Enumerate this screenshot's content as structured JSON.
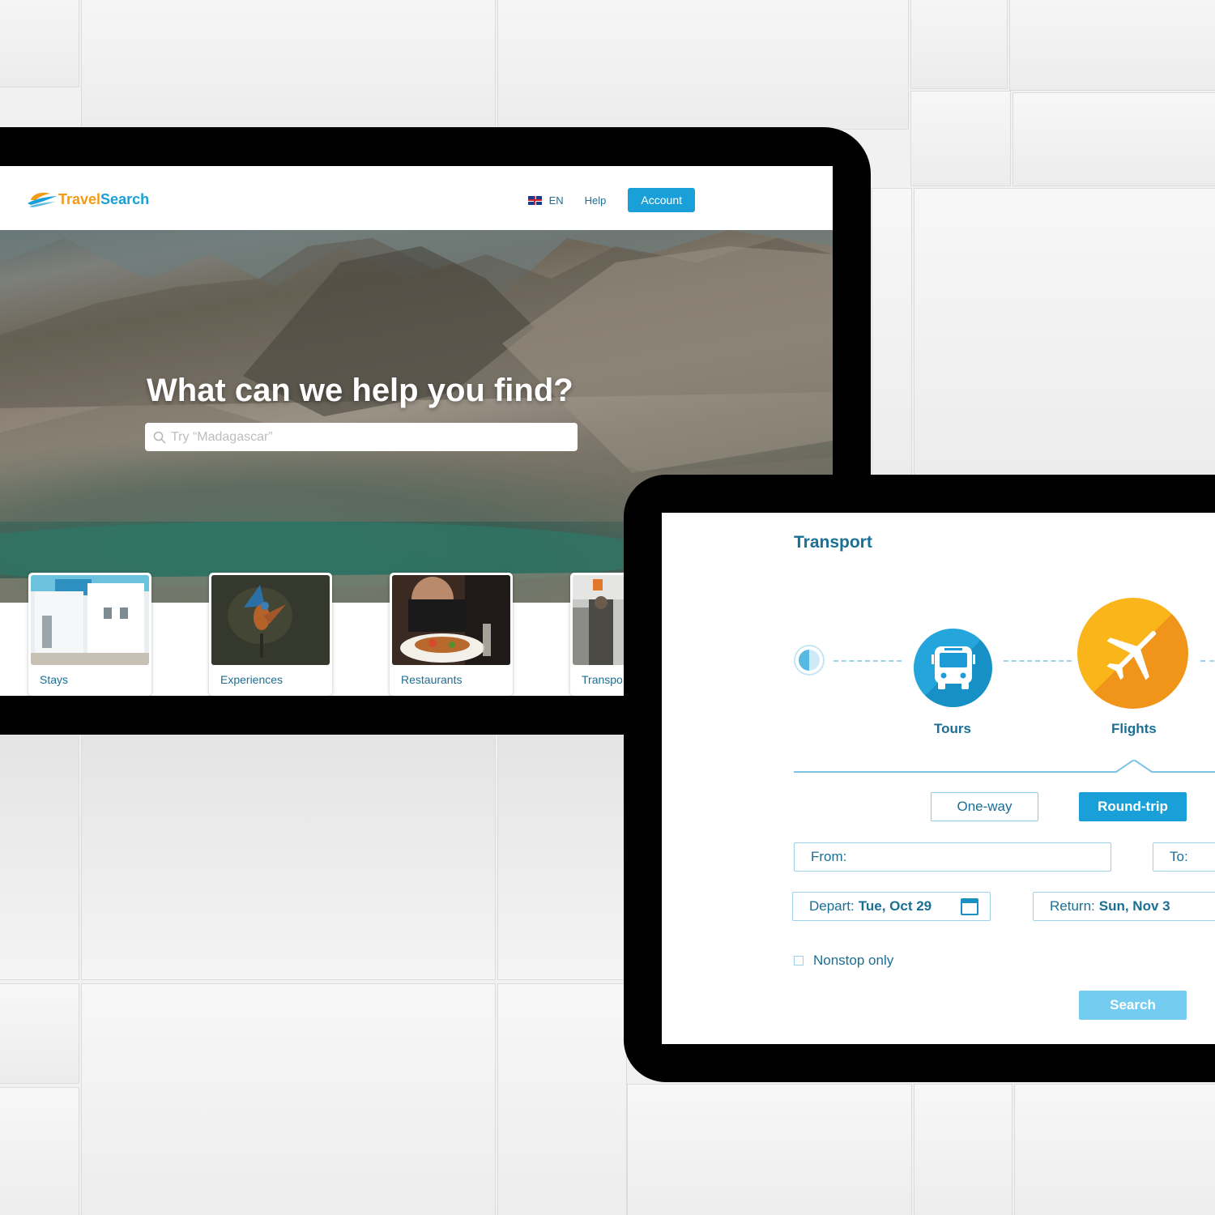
{
  "website": {
    "brand": {
      "part1": "Travel",
      "part2": "Search"
    },
    "nav": {
      "language": "EN",
      "help": "Help",
      "account": "Account"
    },
    "hero": {
      "headline": "What can we help you find?",
      "search_placeholder": "Try “Madagascar”"
    },
    "categories": [
      {
        "label": "Stays"
      },
      {
        "label": "Experiences"
      },
      {
        "label": "Restaurants"
      },
      {
        "label": "Transpo"
      }
    ]
  },
  "transport": {
    "title": "Transport",
    "modes": [
      {
        "label": "Tours",
        "icon": "bus-icon"
      },
      {
        "label": "Flights",
        "icon": "airplane-icon"
      }
    ],
    "trip_types": {
      "one_way": "One-way",
      "round_trip": "Round-trip",
      "selected": "Round-trip"
    },
    "from_label": "From:",
    "to_label": "To:",
    "depart": {
      "label": "Depart:",
      "value": "Tue, Oct 29"
    },
    "return": {
      "label": "Return:",
      "value": "Sun, Nov 3"
    },
    "nonstop_label": "Nonstop only",
    "nonstop_checked": false,
    "search_label": "Search"
  },
  "colors": {
    "brand_blue": "#1aa0d8",
    "brand_orange": "#f39a16",
    "text_blue": "#1a6f95",
    "disabled_search": "#74cdf0"
  }
}
